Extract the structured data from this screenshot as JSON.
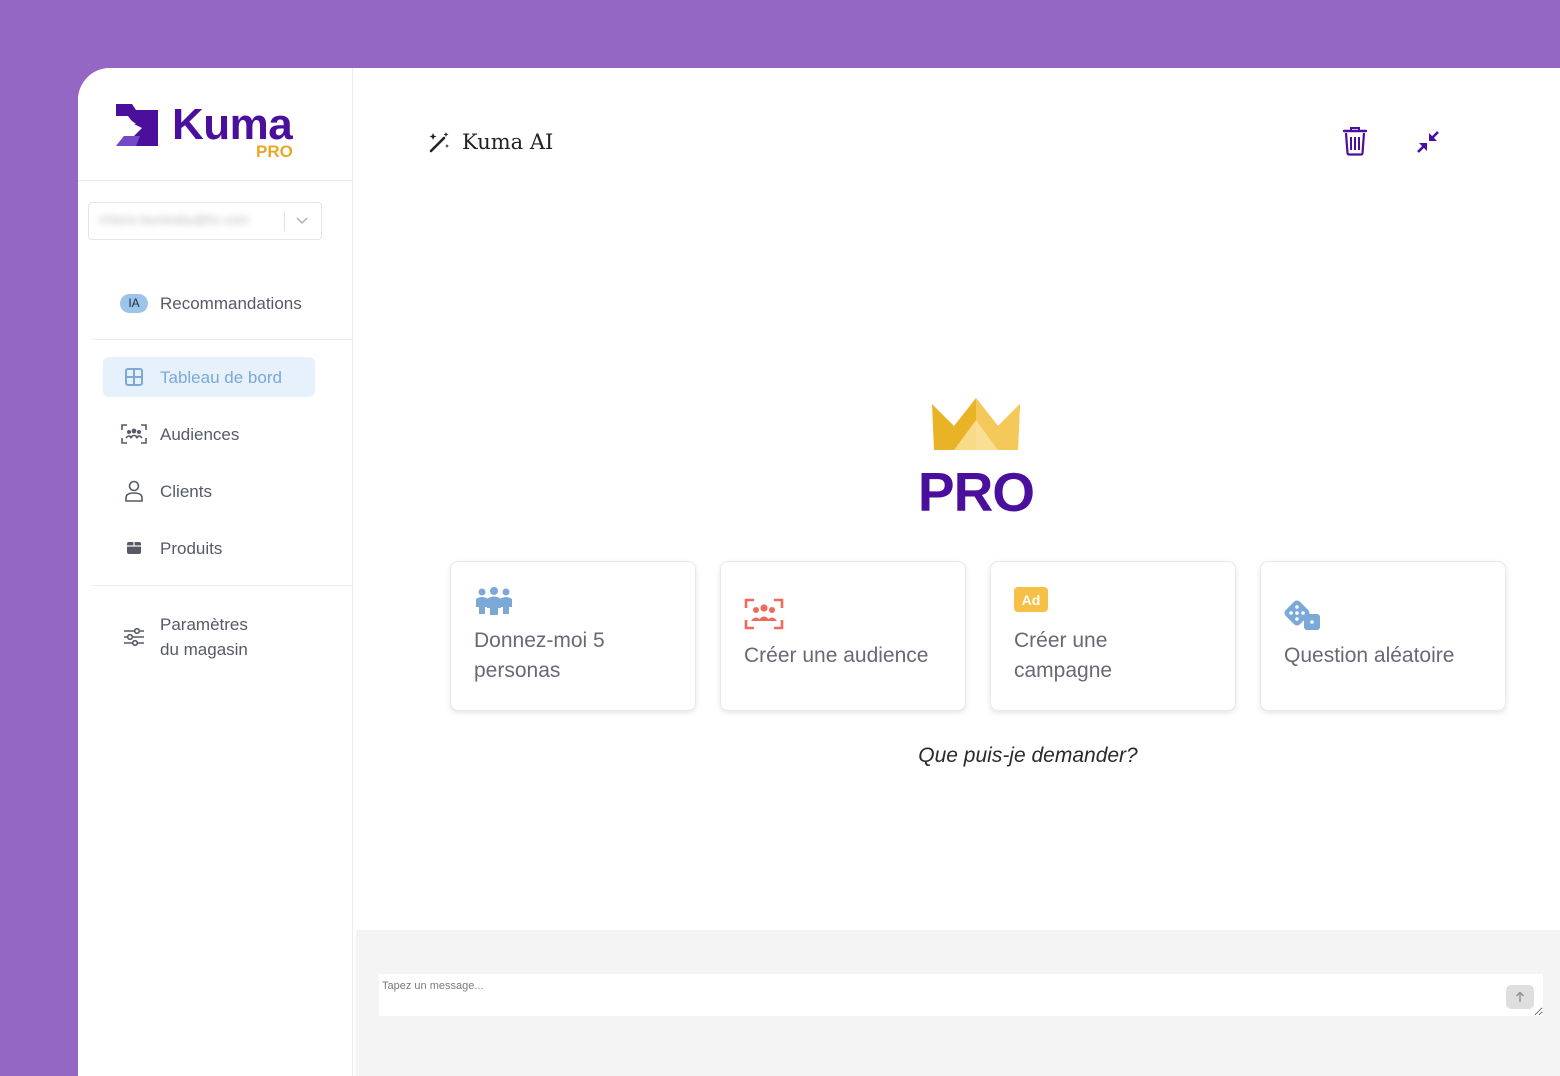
{
  "brand": {
    "name": "Kuma",
    "tier": "PRO",
    "primary_color": "#4b0f9e",
    "accent_color": "#e8a826",
    "background_color": "#9567c4"
  },
  "store_selector": {
    "value": "chiens-laurieaby@hc.com"
  },
  "sidebar": {
    "items": [
      {
        "badge": "IA",
        "label": "Recommandations",
        "icon": "ia-badge"
      },
      {
        "label": "Tableau de bord",
        "icon": "grid-icon",
        "active": true
      },
      {
        "label": "Audiences",
        "icon": "audience-icon"
      },
      {
        "label": "Clients",
        "icon": "user-icon"
      },
      {
        "label": "Produits",
        "icon": "box-icon"
      },
      {
        "label_line1": "Paramètres",
        "label_line2": "du magasin",
        "icon": "sliders-icon"
      }
    ]
  },
  "header": {
    "title": "Kuma AI",
    "icon": "magic-wand-icon"
  },
  "toolbar": {
    "delete_icon": "trash-icon",
    "collapse_icon": "collapse-icon"
  },
  "hero": {
    "title": "PRO",
    "icon": "crown-icon",
    "crown_color": "#e8b326"
  },
  "suggestions": [
    {
      "line1": "Donnez-moi 5",
      "line2": "personas",
      "icon": "people-icon",
      "color": "#7ba8d6"
    },
    {
      "line1": "Créer une audience",
      "icon": "target-audience-icon",
      "color": "#ef6a5a"
    },
    {
      "line1": "Créer une",
      "line2": "campagne",
      "icon": "ad-icon",
      "icon_text": "Ad",
      "color": "#f6bf45"
    },
    {
      "line1": "Question aléatoire",
      "icon": "dice-icon",
      "color": "#7ba8d6"
    }
  ],
  "hint": "Que puis-je demander?",
  "composer": {
    "placeholder": "Tapez un message..."
  }
}
